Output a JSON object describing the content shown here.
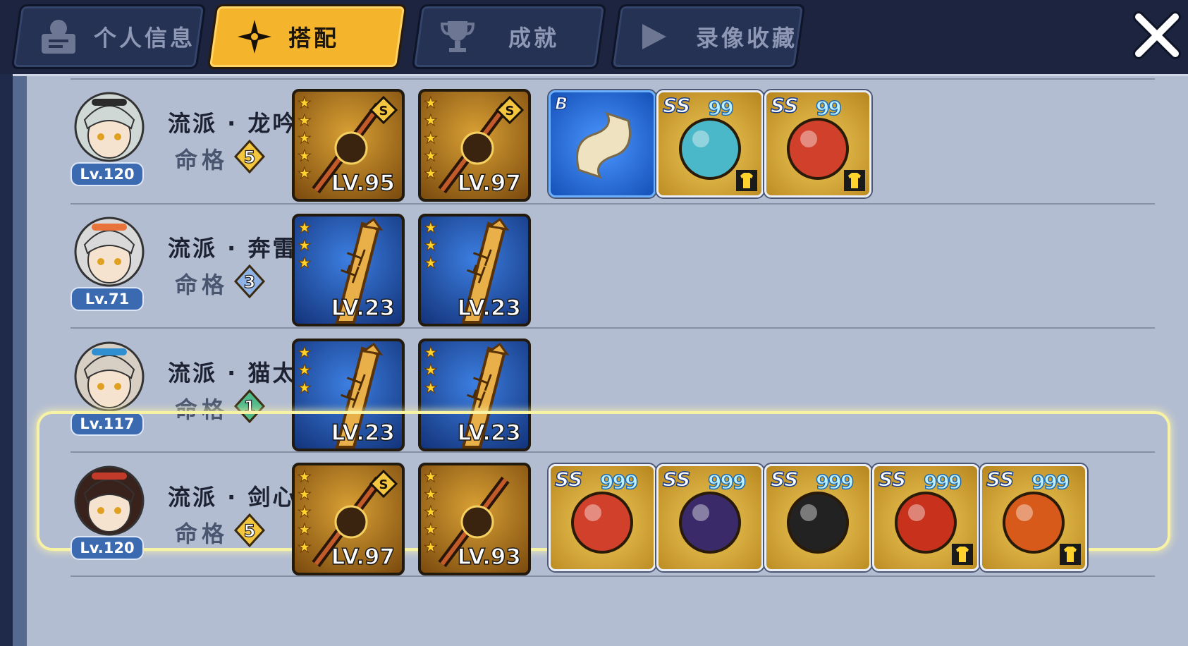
{
  "tabs": [
    {
      "label": "个人信息",
      "icon": "profile-card-icon",
      "active": false
    },
    {
      "label": "搭配",
      "icon": "shuriken-icon",
      "active": true
    },
    {
      "label": "成就",
      "icon": "trophy-icon",
      "active": false
    },
    {
      "label": "录像收藏",
      "icon": "play-icon",
      "active": false
    }
  ],
  "close_icon": "close-icon",
  "fate_label": "命格",
  "rows": [
    {
      "level": "Lv.120",
      "school": "流派 · 龙吟",
      "fate": "5",
      "selected": false,
      "weapons": [
        {
          "stars": 5,
          "level": "LV.95",
          "theme": "gold",
          "s_badge": true,
          "icon": "dragon-brush-icon"
        },
        {
          "stars": 5,
          "level": "LV.97",
          "theme": "gold",
          "s_badge": true,
          "icon": "spear-icon"
        }
      ],
      "items": [
        {
          "grade": "B",
          "theme": "blue",
          "icon": "scroll-icon",
          "dots": "",
          "shirt": false
        },
        {
          "grade": "SS",
          "theme": "gold",
          "icon": "water-orb-icon",
          "dots": "99",
          "shirt": true
        },
        {
          "grade": "SS",
          "theme": "gold",
          "icon": "water-dragon-icon",
          "dots": "99",
          "shirt": true
        }
      ]
    },
    {
      "level": "Lv.71",
      "school": "流派 · 奔雷",
      "fate": "3",
      "selected": false,
      "weapons": [
        {
          "stars": 3,
          "level": "LV.23",
          "theme": "blue",
          "s_badge": false,
          "icon": "wooden-sword-icon"
        },
        {
          "stars": 3,
          "level": "LV.23",
          "theme": "blue",
          "s_badge": false,
          "icon": "wooden-sword-icon"
        }
      ],
      "items": []
    },
    {
      "level": "Lv.117",
      "school": "流派 · 猫太",
      "fate": "1",
      "selected": false,
      "weapons": [
        {
          "stars": 3,
          "level": "LV.23",
          "theme": "blue",
          "s_badge": false,
          "icon": "wooden-sword-icon"
        },
        {
          "stars": 3,
          "level": "LV.23",
          "theme": "blue",
          "s_badge": false,
          "icon": "wooden-sword-icon"
        }
      ],
      "items": []
    },
    {
      "level": "Lv.120",
      "school": "流派 · 剑心",
      "fate": "5",
      "selected": true,
      "weapons": [
        {
          "stars": 5,
          "level": "LV.97",
          "theme": "gold",
          "s_badge": true,
          "icon": "crossed-katana-icon"
        },
        {
          "stars": 5,
          "level": "LV.93",
          "theme": "gold",
          "s_badge": false,
          "icon": "dark-blade-icon"
        }
      ],
      "items": [
        {
          "grade": "SS",
          "theme": "gold",
          "icon": "fire-scarf-icon",
          "dots": "999",
          "shirt": false
        },
        {
          "grade": "SS",
          "theme": "gold",
          "icon": "dark-ring-icon",
          "dots": "999",
          "shirt": false
        },
        {
          "grade": "SS",
          "theme": "gold",
          "icon": "scroll-case-icon",
          "dots": "999",
          "shirt": false
        },
        {
          "grade": "SS",
          "theme": "gold",
          "icon": "flame-crystal-icon",
          "dots": "999",
          "shirt": true
        },
        {
          "grade": "SS",
          "theme": "gold",
          "icon": "flaming-blades-icon",
          "dots": "999",
          "shirt": true
        }
      ]
    }
  ],
  "colors": {
    "accent": "#f4b52d",
    "panel": "#b3bdd2",
    "level_badge": "#3b6ab1"
  }
}
